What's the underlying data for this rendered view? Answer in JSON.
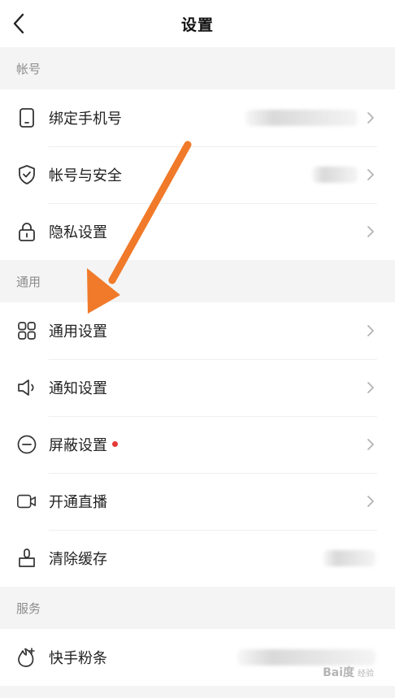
{
  "header": {
    "title": "设置",
    "back_icon": "chevron-left-icon"
  },
  "sections": [
    {
      "label": "帐号",
      "items": [
        {
          "label": "绑定手机号",
          "icon": "phone-icon",
          "right_value": "redacted"
        },
        {
          "label": "帐号与安全",
          "icon": "shield-check-icon",
          "right_value": "redacted"
        },
        {
          "label": "隐私设置",
          "icon": "lock-icon"
        }
      ]
    },
    {
      "label": "通用",
      "items": [
        {
          "label": "通用设置",
          "icon": "grid-icon"
        },
        {
          "label": "通知设置",
          "icon": "speaker-icon"
        },
        {
          "label": "屏蔽设置",
          "icon": "minus-circle-icon",
          "badge": "red-dot"
        },
        {
          "label": "开通直播",
          "icon": "video-camera-icon"
        },
        {
          "label": "清除缓存",
          "icon": "broom-icon",
          "right_value": "redacted"
        }
      ]
    },
    {
      "label": "服务",
      "items": [
        {
          "label": "快手粉条",
          "icon": "flame-plus-icon",
          "right_value": "redacted"
        }
      ]
    }
  ],
  "annotation": {
    "arrow_color": "#f07a2a",
    "points_to": "通用设置"
  },
  "watermark": {
    "text": "Bai度",
    "subtext": "经验"
  },
  "colors": {
    "background": "#f4f4f4",
    "section_text": "#8c8c8c",
    "chevron": "#b3b3b3",
    "badge_dot": "#e53935"
  }
}
